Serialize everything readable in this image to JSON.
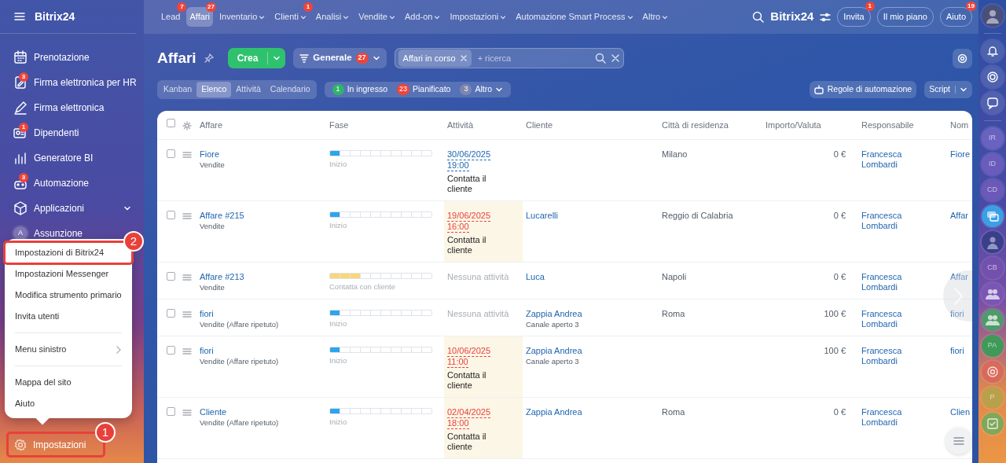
{
  "sidebar": {
    "title": "Bitrix24",
    "items": [
      {
        "label": "Prenotazione"
      },
      {
        "label": "Firma elettronica per HR",
        "badge": "3"
      },
      {
        "label": "Firma elettronica"
      },
      {
        "label": "Dipendenti",
        "badge": "1"
      },
      {
        "label": "Generatore BI"
      },
      {
        "label": "Automazione",
        "badge": "3"
      },
      {
        "label": "Applicazioni",
        "submenu": true
      },
      {
        "label": "Assunzione",
        "avatar": "A"
      }
    ],
    "settings": {
      "label": "Impostazioni",
      "callout": "1"
    }
  },
  "top_nav": [
    {
      "label": "Lead",
      "badge": "7",
      "dropdown": false,
      "selected": false
    },
    {
      "label": "Affari",
      "badge": "27",
      "dropdown": false,
      "selected": true
    },
    {
      "label": "Inventario",
      "dropdown": true,
      "selected": false
    },
    {
      "label": "Clienti",
      "badge": "1",
      "dropdown": true,
      "selected": false
    },
    {
      "label": "Analisi",
      "dropdown": true,
      "selected": false
    },
    {
      "label": "Vendite",
      "dropdown": true,
      "selected": false
    },
    {
      "label": "Add-on",
      "dropdown": true,
      "selected": false
    },
    {
      "label": "Impostazioni",
      "dropdown": true,
      "selected": false
    },
    {
      "label": "Automazione Smart Process",
      "dropdown": true,
      "selected": false
    },
    {
      "label": "Altro",
      "dropdown": true,
      "selected": false
    }
  ],
  "header_right": {
    "brand": "Bitrix24",
    "buttons": [
      {
        "label": "Invita",
        "badge": "1"
      },
      {
        "label": "Il mio piano"
      },
      {
        "label": "Aiuto",
        "badge": "19"
      }
    ]
  },
  "page": {
    "title": "Affari",
    "create": "Crea",
    "filter": {
      "label": "Generale",
      "count": "27"
    },
    "search": {
      "tag": "Affari in corso",
      "placeholder": "+ ricerca"
    }
  },
  "view_tabs": [
    {
      "label": "Kanban",
      "selected": false
    },
    {
      "label": "Elenco",
      "selected": true
    },
    {
      "label": "Attività",
      "selected": false
    },
    {
      "label": "Calendario",
      "selected": false
    }
  ],
  "counters": [
    {
      "count": "1",
      "label": "In ingresso",
      "color": "#2fb56a",
      "dropdown": false
    },
    {
      "count": "23",
      "label": "Pianificato",
      "color": "#f0443a",
      "dropdown": false
    },
    {
      "count": "3",
      "label": "Altro",
      "color": "#7d86b0",
      "dropdown": true
    }
  ],
  "automation_button": "Regole di automazione",
  "script_button": "Script",
  "table": {
    "select_all_checked": false,
    "columns": [
      "Affare",
      "Fase",
      "Attività",
      "Cliente",
      "Città di residenza",
      "Importo/Valuta",
      "Responsabile",
      "Nom"
    ],
    "rows": [
      {
        "checked": false,
        "deal": "Fiore",
        "pipeline": "Vendite",
        "stage": {
          "label": "Inizio",
          "level": 0.1,
          "color": "#2fa4ee"
        },
        "activity": {
          "kind": "scheduled",
          "date": "30/06/2025",
          "time": "19:00",
          "task": "Contatta il cliente",
          "overdue": false
        },
        "city": "Milano",
        "amount": "0 €",
        "owner": "Francesca Lombardi",
        "name": "Fiore"
      },
      {
        "checked": false,
        "deal": "Affare #215",
        "pipeline": "Vendite",
        "stage": {
          "label": "Inizio",
          "level": 0.1,
          "color": "#2fa4ee"
        },
        "activity": {
          "kind": "scheduled",
          "date": "19/06/2025",
          "time": "16:00",
          "task": "Contatta il cliente",
          "overdue": true
        },
        "client": "Lucarelli",
        "city": "Reggio di Calabria",
        "amount": "0 €",
        "owner": "Francesca Lombardi",
        "name": "Affar"
      },
      {
        "checked": false,
        "deal": "Affare #213",
        "pipeline": "Vendite",
        "stage": {
          "label": "Contatta con cliente",
          "level": 0.3,
          "color": "#fad67a"
        },
        "activity": {
          "kind": "none",
          "text": "Nessuna attività"
        },
        "client": "Luca",
        "city": "Napoli",
        "amount": "0 €",
        "owner": "Francesca Lombardi",
        "name": "Affar"
      },
      {
        "checked": false,
        "deal": "fiori",
        "pipeline": "Vendite (Affare ripetuto)",
        "stage": {
          "label": "Inizio",
          "level": 0.1,
          "color": "#2fa4ee"
        },
        "activity": {
          "kind": "none",
          "text": "Nessuna attività"
        },
        "client": "Zappia Andrea",
        "client_note": "Canale aperto 3",
        "city": "Roma",
        "amount": "100 €",
        "owner": "Francesca Lombardi",
        "name": "fiori"
      },
      {
        "checked": false,
        "deal": "fiori",
        "pipeline": "Vendite (Affare ripetuto)",
        "stage": {
          "label": "Inizio",
          "level": 0.1,
          "color": "#2fa4ee"
        },
        "activity": {
          "kind": "scheduled",
          "date": "10/06/2025",
          "time": "11:00",
          "task": "Contatta il cliente",
          "overdue": true
        },
        "client": "Zappia Andrea",
        "client_note": "Canale aperto 3",
        "amount": "100 €",
        "owner": "Francesca Lombardi",
        "name": "fiori"
      },
      {
        "checked": false,
        "deal": "Cliente",
        "pipeline": "Vendite (Affare ripetuto)",
        "stage": {
          "label": "Inizio",
          "level": 0.1,
          "color": "#2fa4ee"
        },
        "activity": {
          "kind": "scheduled",
          "date": "02/04/2025",
          "time": "18:00",
          "task": "Contatta il cliente",
          "overdue": true
        },
        "client": "Zappia Andrea",
        "city": "Roma",
        "amount": "0 €",
        "owner": "Francesca Lombardi",
        "name": "Clien"
      }
    ]
  },
  "settings_menu": {
    "groups": [
      {
        "items": [
          {
            "label": "Impostazioni di Bitrix24",
            "submenu": false,
            "callout": "2"
          },
          {
            "label": "Impostazioni Messenger",
            "submenu": false
          },
          {
            "label": "Modifica strumento primario",
            "submenu": false
          },
          {
            "label": "Invita utenti",
            "submenu": false
          }
        ]
      },
      {
        "items": [
          {
            "label": "Menu sinistro",
            "submenu": true
          }
        ]
      },
      {
        "items": [
          {
            "label": "Mappa del sito",
            "submenu": false
          },
          {
            "label": "Aiuto",
            "submenu": false
          }
        ]
      }
    ]
  },
  "right_rail": [
    {
      "kind": "initials",
      "text": "IR",
      "color": "#6a62c0"
    },
    {
      "kind": "initials",
      "text": "ID",
      "color": "#6a5cbc"
    },
    {
      "kind": "initials",
      "text": "CD",
      "color": "#6c58b8"
    },
    {
      "kind": "chat",
      "color": "#3aa0e6"
    },
    {
      "kind": "photo",
      "color": "#3a3f8a"
    },
    {
      "kind": "initials",
      "text": "CB",
      "color": "#7450ae"
    },
    {
      "kind": "group",
      "color": "#7a56b4"
    },
    {
      "kind": "group",
      "color": "#4f9a6a"
    },
    {
      "kind": "initials",
      "text": "PA",
      "color": "#3f9a5a"
    },
    {
      "kind": "target",
      "color": "#d96a5a"
    },
    {
      "kind": "initials",
      "text": "P",
      "color": "#b9a04a"
    },
    {
      "kind": "task",
      "color": "#7fa85a"
    }
  ]
}
